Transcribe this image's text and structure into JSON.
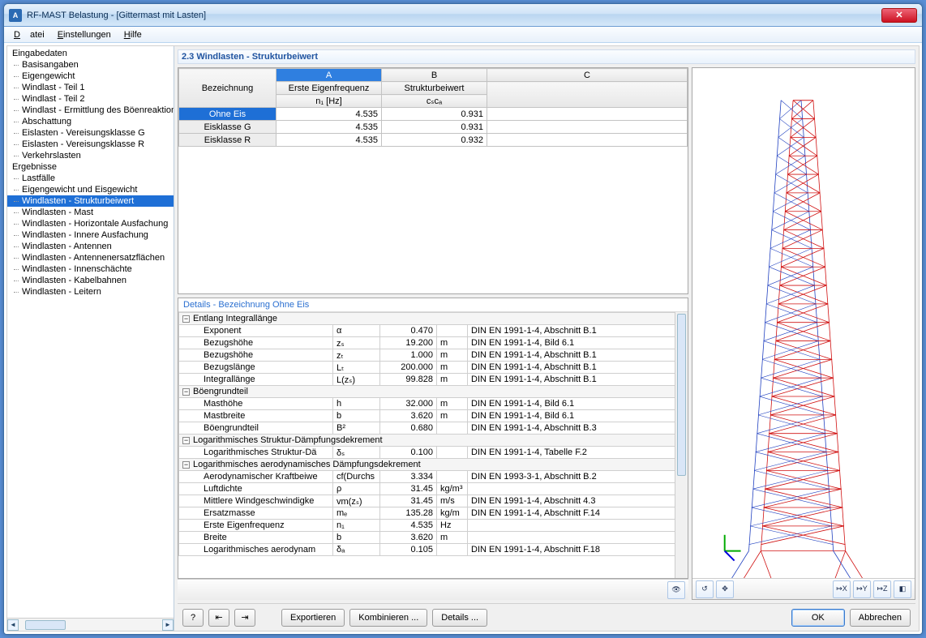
{
  "window": {
    "title": "RF-MAST Belastung - [Gittermast mit Lasten]"
  },
  "menu": {
    "file": "Datei",
    "settings": "Einstellungen",
    "help": "Hilfe"
  },
  "nav": {
    "group1": "Eingabedaten",
    "g1": [
      "Basisangaben",
      "Eigengewicht",
      "Windlast - Teil 1",
      "Windlast - Teil 2",
      "Windlast - Ermittlung des Böenreaktions",
      "Abschattung",
      "Eislasten - Vereisungsklasse G",
      "Eislasten - Vereisungsklasse R",
      "Verkehrslasten"
    ],
    "group2": "Ergebnisse",
    "g2": [
      "Lastfälle",
      "Eigengewicht und Eisgewicht",
      "Windlasten - Strukturbeiwert",
      "Windlasten - Mast",
      "Windlasten - Horizontale Ausfachung",
      "Windlasten - Innere Ausfachung",
      "Windlasten - Antennen",
      "Windlasten - Antennenersatzflächen",
      "Windlasten - Innenschächte",
      "Windlasten - Kabelbahnen",
      "Windlasten - Leitern"
    ]
  },
  "heading": "2.3 Windlasten - Strukturbeiwert",
  "table": {
    "h_bez": "Bezeichnung",
    "h_A": "A",
    "h_Asub": "Erste Eigenfrequenz",
    "h_Aunit": "n₁ [Hz]",
    "h_B": "B",
    "h_Bsub": "Strukturbeiwert",
    "h_Bunit": "cₛcₐ",
    "h_C": "C",
    "rows": [
      {
        "bez": "Ohne Eis",
        "a": "4.535",
        "b": "0.931",
        "c": ""
      },
      {
        "bez": "Eisklasse G",
        "a": "4.535",
        "b": "0.931",
        "c": ""
      },
      {
        "bez": "Eisklasse R",
        "a": "4.535",
        "b": "0.932",
        "c": ""
      }
    ]
  },
  "details": {
    "title": "Details  -  Bezeichnung Ohne Eis",
    "sections": [
      {
        "sec": "Entlang Integrallänge",
        "rows": [
          {
            "n": "Exponent",
            "s": "α",
            "v": "0.470",
            "u": "",
            "r": "DIN EN 1991-1-4, Abschnitt B.1"
          },
          {
            "n": "Bezugshöhe",
            "s": "zₛ",
            "v": "19.200",
            "u": "m",
            "r": "DIN EN 1991-1-4, Bild 6.1"
          },
          {
            "n": "Bezugshöhe",
            "s": "zₜ",
            "v": "1.000",
            "u": "m",
            "r": "DIN EN 1991-1-4, Abschnitt B.1"
          },
          {
            "n": "Bezugslänge",
            "s": "Lₜ",
            "v": "200.000",
            "u": "m",
            "r": "DIN EN 1991-1-4, Abschnitt B.1"
          },
          {
            "n": "Integrallänge",
            "s": "L(zₛ)",
            "v": "99.828",
            "u": "m",
            "r": "DIN EN 1991-1-4, Abschnitt B.1"
          }
        ]
      },
      {
        "sec": "Böengrundteil",
        "rows": [
          {
            "n": "Masthöhe",
            "s": "h",
            "v": "32.000",
            "u": "m",
            "r": "DIN EN 1991-1-4, Bild 6.1"
          },
          {
            "n": "Mastbreite",
            "s": "b",
            "v": "3.620",
            "u": "m",
            "r": "DIN EN 1991-1-4, Bild 6.1"
          },
          {
            "n": "Böengrundteil",
            "s": "B²",
            "v": "0.680",
            "u": "",
            "r": "DIN EN 1991-1-4, Abschnitt B.3"
          }
        ]
      },
      {
        "sec": "Logarithmisches Struktur-Dämpfungsdekrement",
        "rows": [
          {
            "n": "Logarithmisches Struktur-Dä",
            "s": "δₛ",
            "v": "0.100",
            "u": "",
            "r": "DIN EN 1991-1-4, Tabelle F.2"
          }
        ]
      },
      {
        "sec": "Logarithmisches aerodynamisches Dämpfungsdekrement",
        "rows": [
          {
            "n": "Aerodynamischer Kraftbeiwe",
            "s": "cf(Durchs",
            "v": "3.334",
            "u": "",
            "r": "DIN EN 1993-3-1, Abschnitt B.2"
          },
          {
            "n": "Luftdichte",
            "s": "ρ",
            "v": "31.45",
            "u": "kg/m³",
            "r": ""
          },
          {
            "n": "Mittlere Windgeschwindigke",
            "s": "vm(zₛ)",
            "v": "31.45",
            "u": "m/s",
            "r": "DIN EN 1991-1-4, Abschnitt 4.3"
          },
          {
            "n": "Ersatzmasse",
            "s": "mₑ",
            "v": "135.28",
            "u": "kg/m",
            "r": "DIN EN 1991-1-4, Abschnitt F.14"
          },
          {
            "n": "Erste Eigenfrequenz",
            "s": "n₁",
            "v": "4.535",
            "u": "Hz",
            "r": ""
          },
          {
            "n": "Breite",
            "s": "b",
            "v": "3.620",
            "u": "m",
            "r": ""
          },
          {
            "n": "Logarithmisches aerodynam",
            "s": "δₐ",
            "v": "0.105",
            "u": "",
            "r": "DIN EN 1991-1-4, Abschnitt F.18"
          }
        ]
      }
    ]
  },
  "footer": {
    "export": "Exportieren",
    "combine": "Kombinieren ...",
    "details": "Details ...",
    "ok": "OK",
    "cancel": "Abbrechen"
  }
}
